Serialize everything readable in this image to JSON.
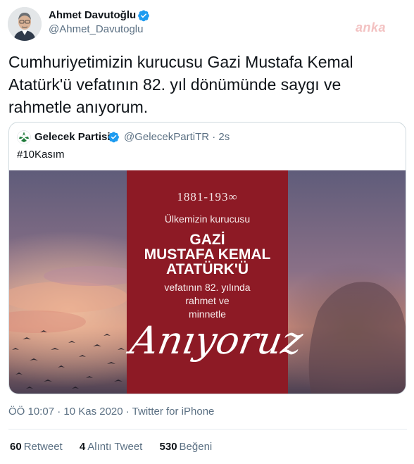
{
  "author": {
    "display_name": "Ahmet Davutoğlu",
    "handle": "@Ahmet_Davutoglu",
    "verified": true
  },
  "watermark": "anka",
  "tweet_text": "Cumhuriyetimizin kurucusu Gazi Mustafa Kemal Atatürk'ü vefatının 82. yıl dönümünde saygı ve rahmetle anıyorum.",
  "quoted_tweet": {
    "display_name": "Gelecek Partisi",
    "handle_time": "@GelecekPartiTR · 2s",
    "verified": true,
    "text": "#10Kasım",
    "poster": {
      "years": "1881-193∞",
      "line1": "Ülkemizin kurucusu",
      "gazi": "GAZİ",
      "name": "MUSTAFA KEMAL",
      "surname": "ATATÜRK'Ü",
      "line2": "vefatının 82. yılında",
      "line3": "rahmet ve",
      "line4": "minnetle",
      "script": "Anıyoruz"
    }
  },
  "meta": "ÖÖ 10:07 · 10 Kas 2020 · Twitter for iPhone",
  "stats": {
    "retweets_count": "60",
    "retweets_label": "Retweet",
    "quotes_count": "4",
    "quotes_label": "Alıntı Tweet",
    "likes_count": "530",
    "likes_label": "Beğeni"
  },
  "colors": {
    "verified_blue": "#1d9bf0",
    "poster_red": "#8d1a25",
    "secondary_text": "#5b7083"
  }
}
